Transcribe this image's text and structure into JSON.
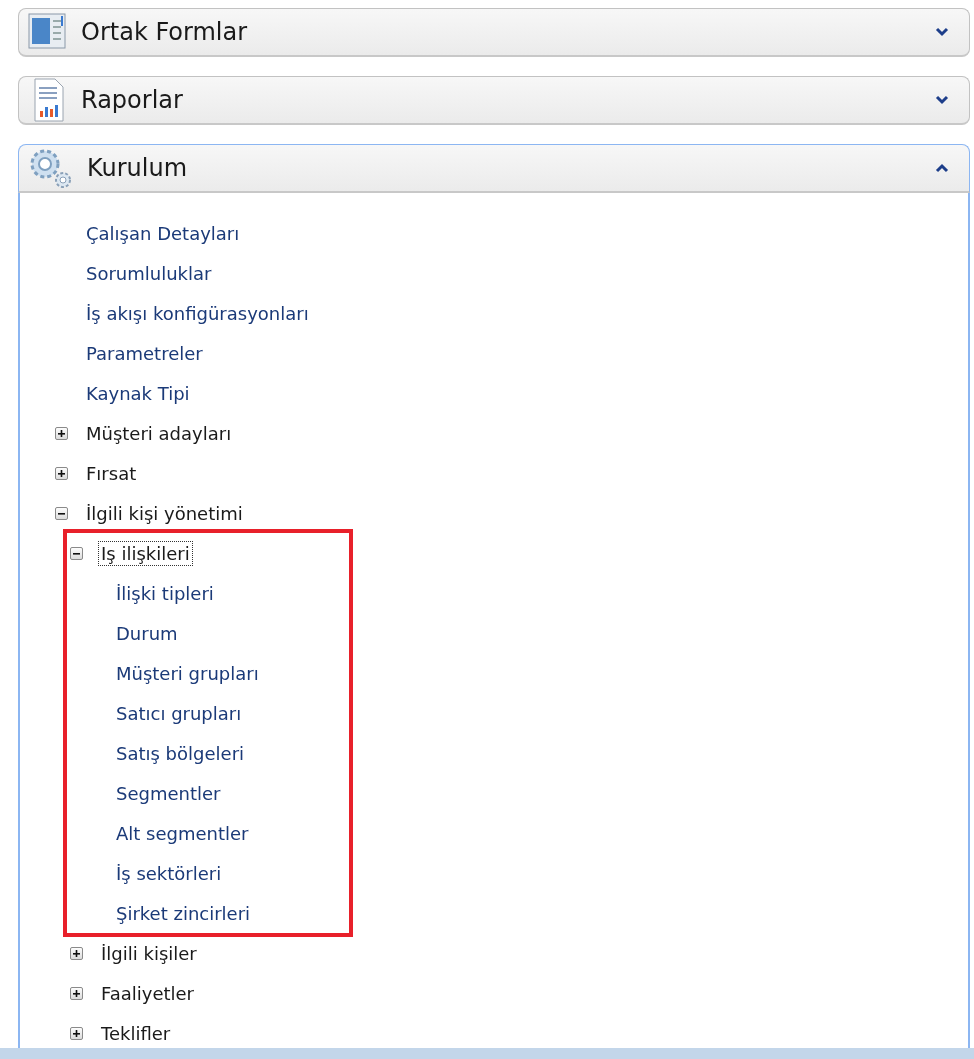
{
  "panels": [
    {
      "title": "Ortak Formlar",
      "expanded": false
    },
    {
      "title": "Raporlar",
      "expanded": false
    },
    {
      "title": "Kurulum",
      "expanded": true,
      "tree": [
        {
          "label": "Çalışan Detayları",
          "kind": "leaf"
        },
        {
          "label": "Sorumluluklar",
          "kind": "leaf"
        },
        {
          "label": "İş akışı konfigürasyonları",
          "kind": "leaf"
        },
        {
          "label": "Parametreler",
          "kind": "leaf"
        },
        {
          "label": "Kaynak Tipi",
          "kind": "leaf"
        },
        {
          "label": "Müşteri adayları",
          "kind": "group",
          "expanded": false
        },
        {
          "label": "Fırsat",
          "kind": "group",
          "expanded": false
        },
        {
          "label": "İlgili kişi yönetimi",
          "kind": "group",
          "expanded": true,
          "children": [
            {
              "label": "Iş ilişkileri",
              "kind": "group",
              "expanded": true,
              "focused": true,
              "highlighted": true,
              "children": [
                {
                  "label": "İlişki tipleri",
                  "kind": "leaf"
                },
                {
                  "label": "Durum",
                  "kind": "leaf"
                },
                {
                  "label": "Müşteri grupları",
                  "kind": "leaf"
                },
                {
                  "label": "Satıcı grupları",
                  "kind": "leaf"
                },
                {
                  "label": "Satış bölgeleri",
                  "kind": "leaf"
                },
                {
                  "label": "Segmentler",
                  "kind": "leaf"
                },
                {
                  "label": "Alt segmentler",
                  "kind": "leaf"
                },
                {
                  "label": "İş sektörleri",
                  "kind": "leaf"
                },
                {
                  "label": "Şirket zincirleri",
                  "kind": "leaf"
                }
              ]
            },
            {
              "label": "İlgili kişiler",
              "kind": "group",
              "expanded": false
            },
            {
              "label": "Faaliyetler",
              "kind": "group",
              "expanded": false
            },
            {
              "label": "Teklifler",
              "kind": "group",
              "expanded": false
            }
          ]
        }
      ]
    }
  ]
}
